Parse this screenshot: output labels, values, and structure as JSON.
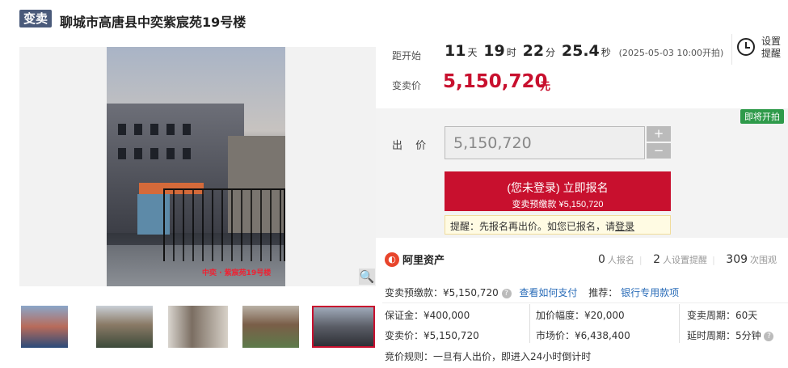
{
  "header": {
    "tag": "变卖",
    "title": "聊城市高唐县中奕紫宸苑19号楼"
  },
  "gallery": {
    "watermark": "中奕 · 紫宸苑19号楼",
    "zoom_icon": "magnifier-icon",
    "thumbnails": 5,
    "selected_thumbnail": 5
  },
  "countdown": {
    "label": "距开始",
    "days": "11",
    "days_unit": "天",
    "hours": "19",
    "hours_unit": "时",
    "minutes": "22",
    "minutes_unit": "分",
    "seconds": "25.4",
    "seconds_unit": "秒",
    "start_text": "(2025-05-03 10:00开拍)"
  },
  "reminder": {
    "icon": "alarm-clock-icon",
    "label": "设置提醒"
  },
  "price": {
    "label": "变卖价",
    "value": "5,150,720",
    "unit": "元"
  },
  "bid": {
    "badge": "即将开拍",
    "label": "出 价",
    "value": "5,150,720",
    "plus": "+",
    "minus": "−",
    "signup_line1": "(您未登录) 立即报名",
    "signup_line2": "变卖预缴款 ¥5,150,720",
    "tip_prefix": "提醒：先报名再出价。如您已报名，请",
    "tip_link": "登录"
  },
  "platform": {
    "name": "阿里资产"
  },
  "stats": {
    "signups": "0",
    "signups_label": "人报名",
    "reminders": "2",
    "reminders_label": "人设置提醒",
    "views": "309",
    "views_label": "次围观"
  },
  "details": {
    "deposit_row": "变卖预缴款：¥5,150,720",
    "how_to_pay": "查看如何支付",
    "recommend_label": "推荐：",
    "recommend_link": "银行专用款项",
    "bond": "保证金：¥400,000",
    "increment": "加价幅度：¥20,000",
    "period": "变卖周期：60天",
    "sale_price": "变卖价：¥5,150,720",
    "market_price": "市场价：¥6,438,400",
    "delay": "延时周期：5分钟",
    "rule": "竞价规则：一旦有人出价，即进入24小时倒计时"
  },
  "colors": {
    "accent": "#c8102e",
    "tag_bg": "#4a5a7a",
    "badge_green": "#2e9a4a",
    "link": "#2a6cb8"
  }
}
